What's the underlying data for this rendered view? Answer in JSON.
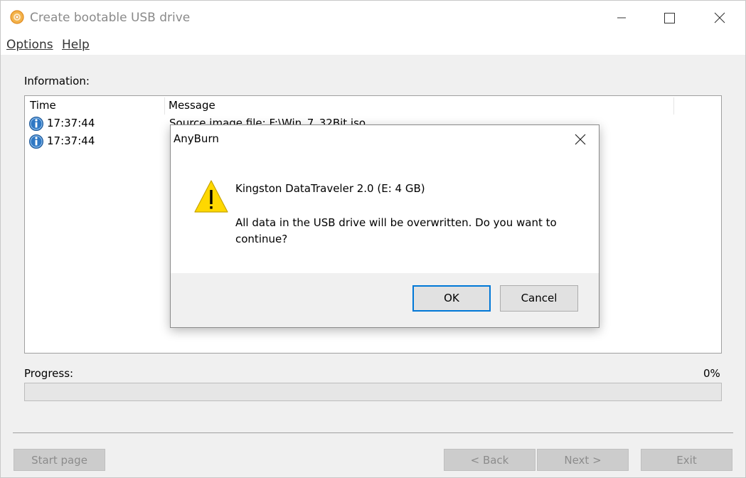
{
  "window": {
    "title": "Create bootable USB drive"
  },
  "menu": {
    "options": "Options",
    "help": "Help"
  },
  "information": {
    "label": "Information:",
    "columns": {
      "time": "Time",
      "message": "Message"
    },
    "rows": [
      {
        "time": "17:37:44",
        "message": "Source image file: F:\\Win_7_32Bit.iso"
      },
      {
        "time": "17:37:44",
        "message": ""
      }
    ]
  },
  "progress": {
    "label": "Progress:",
    "percent_text": "0%",
    "value": 0
  },
  "footer": {
    "start_page": "Start page",
    "back": "< Back",
    "next": "Next >",
    "exit": "Exit"
  },
  "dialog": {
    "title": "AnyBurn",
    "device": "Kingston DataTraveler 2.0 (E:  4 GB)",
    "message": "All data in the USB drive will be overwritten. Do you want to continue?",
    "ok": "OK",
    "cancel": "Cancel"
  },
  "icons": {
    "app": "disc-icon",
    "info": "info-icon",
    "warning": "warning-icon",
    "minimize": "minimize-icon",
    "maximize": "maximize-icon",
    "close": "close-icon"
  },
  "colors": {
    "accent": "#0078d7",
    "warning": "#ffd800",
    "progress": "#06b025"
  }
}
